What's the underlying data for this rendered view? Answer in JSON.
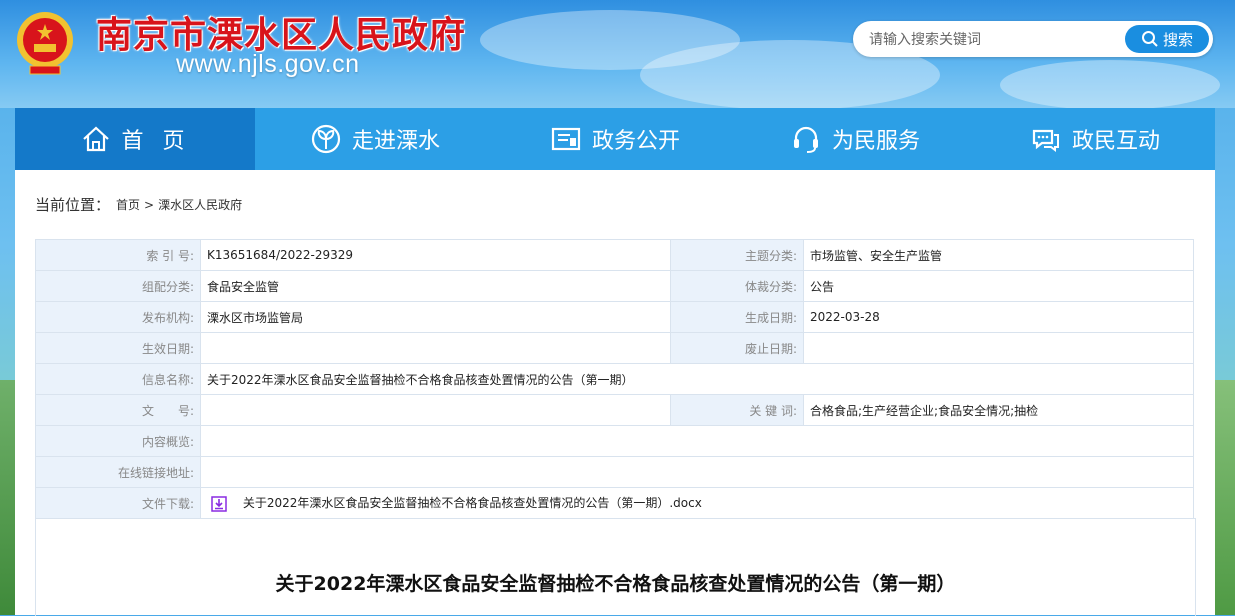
{
  "header": {
    "site_title": "南京市溧水区人民政府",
    "site_url": "www.njls.gov.cn",
    "search_placeholder": "请输入搜索关键词",
    "search_button": "搜索"
  },
  "nav": {
    "items": [
      {
        "label": "首 页",
        "icon": "home-icon"
      },
      {
        "label": "走进溧水",
        "icon": "leaf-icon"
      },
      {
        "label": "政务公开",
        "icon": "document-icon"
      },
      {
        "label": "为民服务",
        "icon": "headset-icon"
      },
      {
        "label": "政民互动",
        "icon": "chat-icon"
      }
    ]
  },
  "breadcrumb": {
    "label": "当前位置：",
    "items": [
      "首页",
      "溧水区人民政府"
    ],
    "separator": ">"
  },
  "meta": {
    "index_key": "索 引 号:",
    "index_val": "K13651684/2022-29329",
    "topic_key": "主题分类:",
    "topic_val": "市场监管、安全生产监管",
    "group_key": "组配分类:",
    "group_val": "食品安全监管",
    "genre_key": "体裁分类:",
    "genre_val": "公告",
    "publisher_key": "发布机构:",
    "publisher_val": "溧水区市场监管局",
    "created_key": "生成日期:",
    "created_val": "2022-03-28",
    "effective_key": "生效日期:",
    "effective_val": "",
    "abolish_key": "废止日期:",
    "abolish_val": "",
    "name_key": "信息名称:",
    "name_val": "关于2022年溧水区食品安全监督抽检不合格食品核查处置情况的公告（第一期）",
    "docno_key": "文　　号:",
    "docno_val": "",
    "keywords_key": "关 键 词:",
    "keywords_val": "合格食品;生产经营企业;食品安全情况;抽检",
    "summary_key": "内容概览:",
    "summary_val": "",
    "link_key": "在线链接地址:",
    "link_val": "",
    "download_key": "文件下载:",
    "download_val": "关于2022年溧水区食品安全监督抽检不合格食品核查处置情况的公告（第一期）.docx"
  },
  "article": {
    "title": "关于2022年溧水区食品安全监督抽检不合格食品核查处置情况的公告（第一期）"
  },
  "colors": {
    "nav_bg": "#2c9fe6",
    "nav_active": "#1479c9",
    "title_red": "#d8141b",
    "label_bg": "#eaf2fb"
  }
}
